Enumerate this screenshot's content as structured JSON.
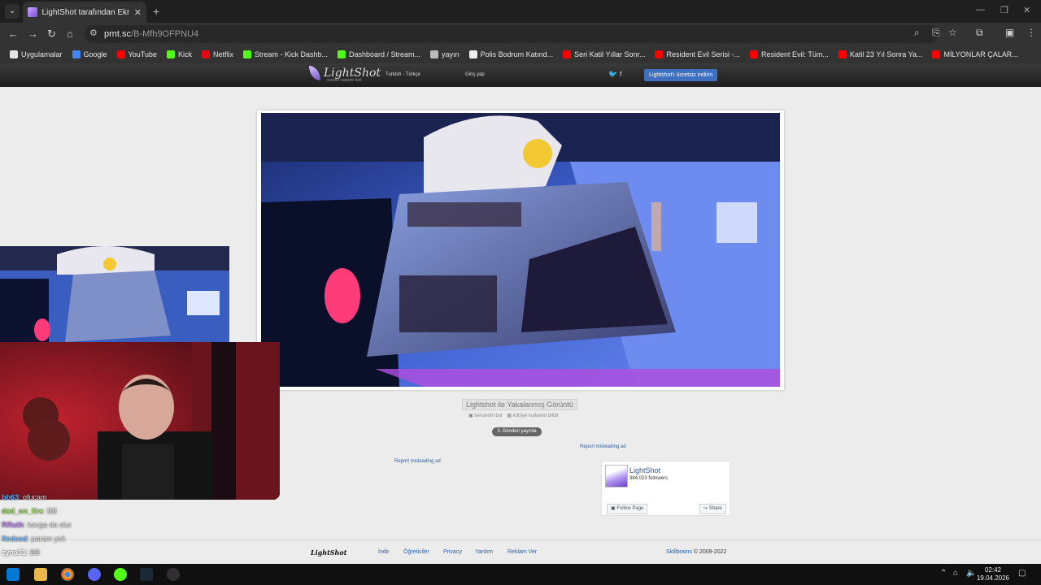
{
  "browser": {
    "tab_title": "LightShot tarafından Ekran Görü",
    "url_host": "prnt.sc",
    "url_path": "/B-Mfh9OFPNU4"
  },
  "bookmarks": [
    {
      "label": "Uygulamalar",
      "color": "#e4e4e4"
    },
    {
      "label": "Google",
      "color": "#4285f4"
    },
    {
      "label": "YouTube",
      "color": "#ff0000"
    },
    {
      "label": "Kick",
      "color": "#53fc18"
    },
    {
      "label": "Netflix",
      "color": "#e50914"
    },
    {
      "label": "Stream - Kick Dashb...",
      "color": "#53fc18"
    },
    {
      "label": "Dashboard / Stream...",
      "color": "#53fc18"
    },
    {
      "label": "yayın",
      "color": "#bbbbbb"
    },
    {
      "label": "Polis Bodrum Katınd...",
      "color": "#eeeeee"
    },
    {
      "label": "Seri Katil Yıllar Sonr...",
      "color": "#ff0000"
    },
    {
      "label": "Resident Evil Serisi -...",
      "color": "#ff0000"
    },
    {
      "label": "Resident Evil: Tüm...",
      "color": "#ff0000"
    },
    {
      "label": "Katil 23 Yıl Sonra Ya...",
      "color": "#ff0000"
    },
    {
      "label": "MİLYONLAR ÇALAR...",
      "color": "#ff0000"
    }
  ],
  "lightshot": {
    "logo": "LightShot",
    "logo_sub": "screen capture tool",
    "language": "Turkish - Türkçe",
    "login": "Giriş yap",
    "download": "Lightshot'ı ücretsiz indirin",
    "caption": "Lightshot ile Yakalanmış Görüntü",
    "similar": "benzerini bul",
    "report_abuse": "kötüye kullanım bildir",
    "tweet": "Gönderi yayınla",
    "report_ad": "Report misleading ad",
    "fb_name": "LightShot",
    "fb_followers": "384,023 followers",
    "fb_follow": "Follow Page",
    "fb_share": "Share"
  },
  "footer": {
    "logo": "LightShot",
    "links": [
      "İndir",
      "Öğreticiler",
      "Privacy",
      "Yardım",
      "Reklam Ver"
    ],
    "copyright_brand": "Skillbrains",
    "copyright_years": "© 2009-2022"
  },
  "chat": [
    {
      "user": "bb63",
      "msg": ": ofucam",
      "color": "#5fb0ff"
    },
    {
      "user": "dad_on_fire",
      "msg": ": BB",
      "color": "#a0e060"
    },
    {
      "user": "RRuth",
      "msg": ": kavga da olur",
      "color": "#c080ff"
    },
    {
      "user": "fledead",
      "msg": ": param yok",
      "color": "#7fc0ff"
    },
    {
      "user": "zyna31",
      "msg": ": BB",
      "color": "#ffffff"
    }
  ],
  "taskbar": {
    "time": "02:42",
    "date": "19.04.2026"
  }
}
